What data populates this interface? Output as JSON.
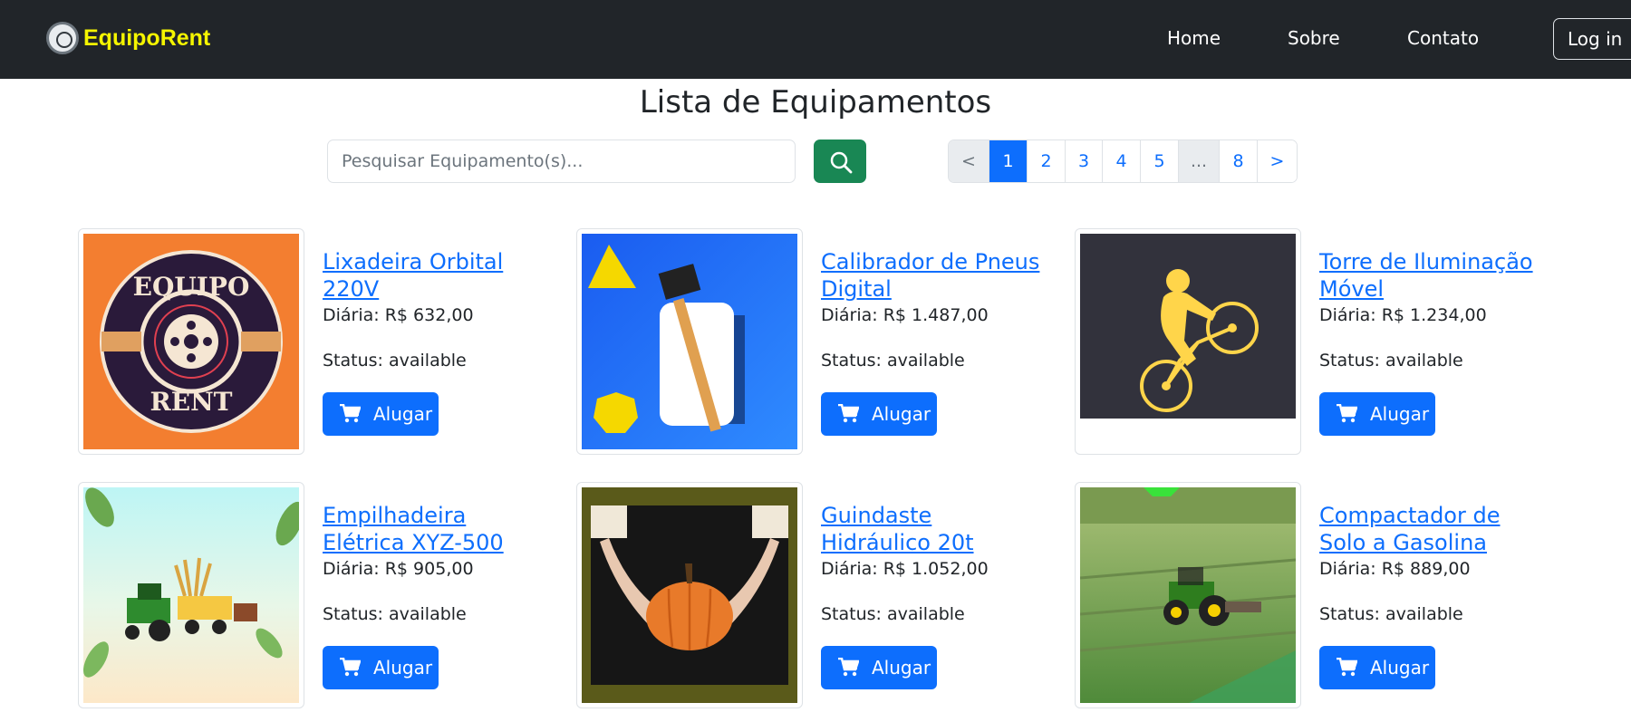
{
  "navbar": {
    "brand": "EquipoRent",
    "links": [
      "Home",
      "Sobre",
      "Contato"
    ],
    "login": "Log in"
  },
  "page_title": "Lista de Equipamentos",
  "search": {
    "placeholder": "Pesquisar Equipamento(s)...",
    "value": ""
  },
  "pagination": {
    "prev": "<",
    "pages": [
      "1",
      "2",
      "3",
      "4",
      "5",
      "...",
      "8"
    ],
    "next": ">",
    "active": "1"
  },
  "items": [
    {
      "title": "Lixadeira Orbital 220V",
      "price": "Diária: R$ 632,00",
      "status": "Status: available",
      "button": "Alugar"
    },
    {
      "title": "Calibrador de Pneus Digital",
      "price": "Diária: R$ 1.487,00",
      "status": "Status: available",
      "button": "Alugar"
    },
    {
      "title": "Torre de Iluminação Móvel",
      "price": "Diária: R$ 1.234,00",
      "status": "Status: available",
      "button": "Alugar"
    },
    {
      "title": "Empilhadeira Elétrica XYZ-500",
      "price": "Diária: R$ 905,00",
      "status": "Status: available",
      "button": "Alugar"
    },
    {
      "title": "Guindaste Hidráulico 20t",
      "price": "Diária: R$ 1.052,00",
      "status": "Status: available",
      "button": "Alugar"
    },
    {
      "title": "Compactador de Solo a Gasolina",
      "price": "Diária: R$ 889,00",
      "status": "Status: available",
      "button": "Alugar"
    }
  ],
  "logo_text": {
    "top": "EQUIPO",
    "bottom": "RENT"
  },
  "colors": {
    "navbar": "#212529",
    "brand": "#f5f500",
    "primary": "#0d6efd",
    "success": "#198754"
  }
}
